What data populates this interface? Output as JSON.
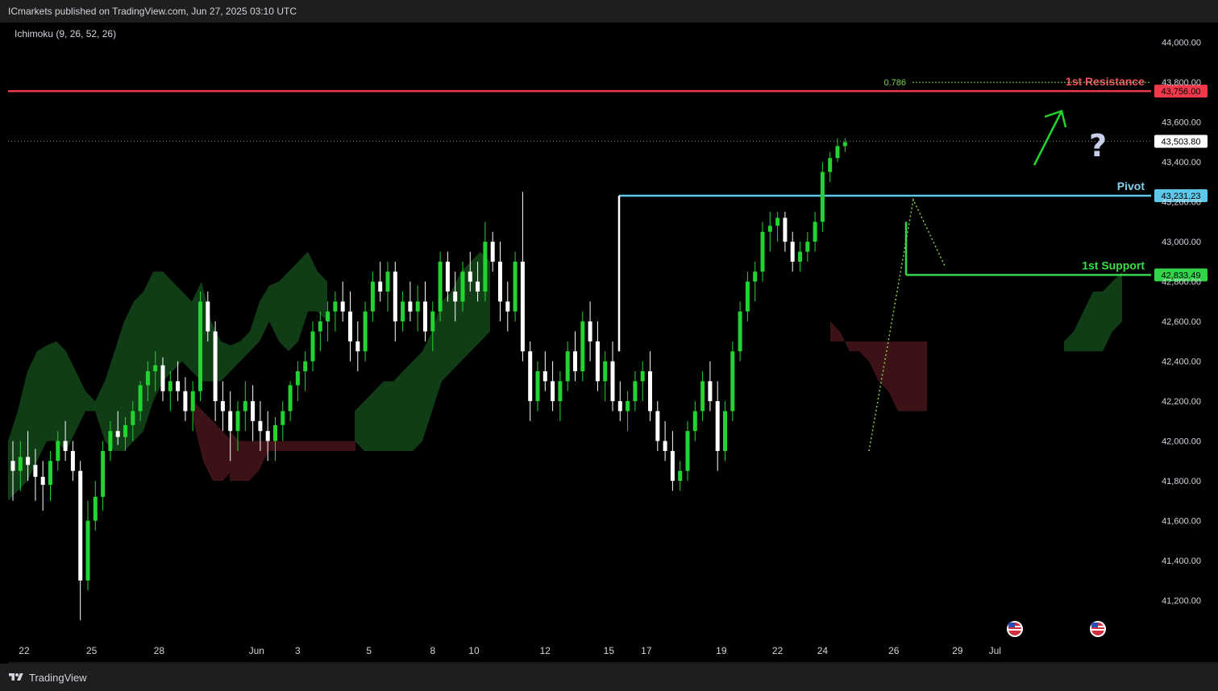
{
  "header": {
    "published": "ICmarkets published on TradingView.com, Jun 27, 2025 03:10 UTC"
  },
  "indicator": {
    "label": "Ichimoku (9, 26, 52, 26)"
  },
  "footer": {
    "brand": "TradingView"
  },
  "colors": {
    "up": "#22d430",
    "down": "#ffffff",
    "resistance": "#f2394b",
    "pivot": "#5ec8e8",
    "support": "#32d54a",
    "cloud_bull": "#113d16",
    "cloud_bear": "#3c1217",
    "axis_bg": "#000000",
    "label_resistance": "#f7525f",
    "label_pivot": "#7fd4ee",
    "label_support": "#35e045",
    "fib": "#7bd34a"
  },
  "icons": [
    "tradingview-logo-icon",
    "question-mark-icon",
    "up-arrow-icon",
    "us-flag-event-icon"
  ],
  "chart_data": {
    "type": "candlestick",
    "title": "",
    "ylim": [
      41000,
      44100
    ],
    "grid": false,
    "y_ticks": [
      "44,000.00",
      "43,800.00",
      "43,600.00",
      "43,400.00",
      "43,200.00",
      "43,000.00",
      "42,800.00",
      "42,600.00",
      "42,400.00",
      "42,200.00",
      "42,000.00",
      "41,800.00",
      "41,600.00",
      "41,400.00",
      "41,200.00"
    ],
    "x_ticks": [
      {
        "label": "22",
        "index": 1.5
      },
      {
        "label": "25",
        "index": 10.5
      },
      {
        "label": "28",
        "index": 19.5
      },
      {
        "label": "Jun",
        "index": 32.5
      },
      {
        "label": "3",
        "index": 38
      },
      {
        "label": "5",
        "index": 47.5
      },
      {
        "label": "8",
        "index": 56
      },
      {
        "label": "10",
        "index": 61.5
      },
      {
        "label": "12",
        "index": 71
      },
      {
        "label": "15",
        "index": 79.5
      },
      {
        "label": "17",
        "index": 84.5
      },
      {
        "label": "19",
        "index": 94.5
      },
      {
        "label": "22",
        "index": 102
      },
      {
        "label": "24",
        "index": 108
      },
      {
        "label": "26",
        "index": 117.5
      },
      {
        "label": "29",
        "index": 126
      },
      {
        "label": "Jul",
        "index": 131
      }
    ],
    "levels": [
      {
        "name": "1st Resistance",
        "value": 43756.0,
        "label": "43,756.00",
        "role": "resistance"
      },
      {
        "name": "Pivot",
        "value": 43231.23,
        "label": "43,231.23",
        "role": "pivot"
      },
      {
        "name": "1st Support",
        "value": 42833.49,
        "label": "42,833.49",
        "role": "support"
      }
    ],
    "last_price": {
      "value": 43503.8,
      "label": "43,503.80"
    },
    "fib": {
      "label": "0.786",
      "value": 43800
    },
    "candles": [
      [
        41900,
        42000,
        41700,
        41850
      ],
      [
        41850,
        42000,
        41750,
        41920
      ],
      [
        41920,
        42050,
        41800,
        41880
      ],
      [
        41880,
        41960,
        41700,
        41820
      ],
      [
        41820,
        41900,
        41650,
        41780
      ],
      [
        41780,
        41950,
        41700,
        41900
      ],
      [
        41900,
        42050,
        41850,
        42000
      ],
      [
        42000,
        42100,
        41900,
        41950
      ],
      [
        41950,
        42000,
        41800,
        41850
      ],
      [
        41850,
        41900,
        41100,
        41300
      ],
      [
        41300,
        41700,
        41250,
        41600
      ],
      [
        41600,
        41800,
        41550,
        41720
      ],
      [
        41720,
        42000,
        41650,
        41950
      ],
      [
        41950,
        42100,
        41900,
        42050
      ],
      [
        42050,
        42150,
        41980,
        42020
      ],
      [
        42020,
        42120,
        41950,
        42080
      ],
      [
        42080,
        42200,
        42000,
        42150
      ],
      [
        42150,
        42300,
        42100,
        42280
      ],
      [
        42280,
        42400,
        42200,
        42350
      ],
      [
        42350,
        42450,
        42250,
        42380
      ],
      [
        42380,
        42420,
        42200,
        42250
      ],
      [
        42250,
        42350,
        42150,
        42300
      ],
      [
        42300,
        42400,
        42200,
        42250
      ],
      [
        42250,
        42320,
        42100,
        42150
      ],
      [
        42150,
        42300,
        42050,
        42250
      ],
      [
        42250,
        42750,
        42200,
        42700
      ],
      [
        42700,
        42750,
        42500,
        42550
      ],
      [
        42550,
        42600,
        42100,
        42200
      ],
      [
        42200,
        42300,
        42050,
        42150
      ],
      [
        42150,
        42250,
        41900,
        42050
      ],
      [
        42050,
        42200,
        41950,
        42150
      ],
      [
        42150,
        42300,
        42050,
        42200
      ],
      [
        42200,
        42280,
        42000,
        42100
      ],
      [
        42100,
        42200,
        41950,
        42050
      ],
      [
        42050,
        42150,
        41900,
        42000
      ],
      [
        42000,
        42120,
        41900,
        42080
      ],
      [
        42080,
        42200,
        42000,
        42150
      ],
      [
        42150,
        42300,
        42100,
        42280
      ],
      [
        42280,
        42400,
        42200,
        42350
      ],
      [
        42350,
        42450,
        42250,
        42400
      ],
      [
        42400,
        42600,
        42350,
        42550
      ],
      [
        42550,
        42650,
        42450,
        42600
      ],
      [
        42600,
        42700,
        42500,
        42650
      ],
      [
        42650,
        42750,
        42550,
        42700
      ],
      [
        42700,
        42800,
        42600,
        42650
      ],
      [
        42650,
        42750,
        42400,
        42500
      ],
      [
        42500,
        42600,
        42350,
        42450
      ],
      [
        42450,
        42700,
        42400,
        42650
      ],
      [
        42650,
        42850,
        42600,
        42800
      ],
      [
        42800,
        42900,
        42700,
        42750
      ],
      [
        42750,
        42900,
        42650,
        42850
      ],
      [
        42850,
        42900,
        42500,
        42600
      ],
      [
        42600,
        42750,
        42550,
        42700
      ],
      [
        42700,
        42800,
        42600,
        42650
      ],
      [
        42650,
        42780,
        42550,
        42700
      ],
      [
        42700,
        42800,
        42500,
        42550
      ],
      [
        42550,
        42700,
        42450,
        42650
      ],
      [
        42650,
        42950,
        42600,
        42900
      ],
      [
        42900,
        42950,
        42700,
        42750
      ],
      [
        42750,
        42850,
        42600,
        42700
      ],
      [
        42700,
        42900,
        42650,
        42850
      ],
      [
        42850,
        42950,
        42750,
        42800
      ],
      [
        42800,
        42900,
        42700,
        42750
      ],
      [
        42750,
        43100,
        42700,
        43000
      ],
      [
        43000,
        43050,
        42850,
        42900
      ],
      [
        42900,
        43000,
        42600,
        42700
      ],
      [
        42700,
        42800,
        42550,
        42650
      ],
      [
        42650,
        42950,
        42600,
        42900
      ],
      [
        42900,
        43250,
        42400,
        42450
      ],
      [
        42450,
        42500,
        42100,
        42200
      ],
      [
        42200,
        42400,
        42150,
        42350
      ],
      [
        42350,
        42450,
        42250,
        42300
      ],
      [
        42300,
        42400,
        42150,
        42200
      ],
      [
        42200,
        42350,
        42100,
        42300
      ],
      [
        42300,
        42500,
        42250,
        42450
      ],
      [
        42450,
        42550,
        42300,
        42350
      ],
      [
        42350,
        42650,
        42300,
        42600
      ],
      [
        42600,
        42700,
        42400,
        42500
      ],
      [
        42500,
        42600,
        42250,
        42300
      ],
      [
        42300,
        42450,
        42200,
        42400
      ],
      [
        42400,
        42500,
        42150,
        42200
      ],
      [
        42200,
        42300,
        42100,
        42150
      ],
      [
        42150,
        42250,
        42050,
        42200
      ],
      [
        42200,
        42350,
        42150,
        42300
      ],
      [
        42300,
        42400,
        42200,
        42350
      ],
      [
        42350,
        42450,
        42100,
        42150
      ],
      [
        42150,
        42200,
        41950,
        42000
      ],
      [
        42000,
        42100,
        41900,
        41950
      ],
      [
        41950,
        42050,
        41750,
        41800
      ],
      [
        41800,
        41900,
        41750,
        41850
      ],
      [
        41850,
        42100,
        41800,
        42050
      ],
      [
        42050,
        42200,
        42000,
        42150
      ],
      [
        42150,
        42350,
        42100,
        42300
      ],
      [
        42300,
        42400,
        42150,
        42200
      ],
      [
        42200,
        42300,
        41850,
        41950
      ],
      [
        41950,
        42200,
        41900,
        42150
      ],
      [
        42150,
        42500,
        42100,
        42450
      ],
      [
        42450,
        42700,
        42400,
        42650
      ],
      [
        42650,
        42850,
        42600,
        42800
      ],
      [
        42800,
        42900,
        42700,
        42850
      ],
      [
        42850,
        43100,
        42800,
        43050
      ],
      [
        43050,
        43150,
        42950,
        43080
      ],
      [
        43080,
        43150,
        43000,
        43120
      ],
      [
        43120,
        43150,
        42950,
        43000
      ],
      [
        43000,
        43050,
        42850,
        42900
      ],
      [
        42900,
        43000,
        42850,
        42950
      ],
      [
        42950,
        43050,
        42900,
        43000
      ],
      [
        43000,
        43150,
        42950,
        43100
      ],
      [
        43100,
        43400,
        43050,
        43350
      ],
      [
        43350,
        43450,
        43300,
        43420
      ],
      [
        43420,
        43520,
        43400,
        43480
      ],
      [
        43480,
        43520,
        43450,
        43500
      ]
    ],
    "cloud": {
      "bull_upper": [
        42000,
        42150,
        42350,
        42450,
        42480,
        42500,
        42450,
        42350,
        42250,
        42200,
        42300,
        42450,
        42600,
        42700,
        42750,
        42850,
        42850,
        42800,
        42750,
        42700,
        42800,
        42600,
        42500,
        42480,
        42500,
        42550,
        42700,
        42780,
        42800,
        42850,
        42900,
        42950,
        42850,
        42800
      ],
      "bull_lower": [
        41700,
        41750,
        41800,
        41900,
        42000,
        42000,
        41950,
        42050,
        42150,
        42150,
        42000,
        41950,
        41950,
        42000,
        42050,
        42200,
        42300,
        42350,
        42400,
        42350,
        42300,
        42300,
        42300,
        42350,
        42400,
        42450,
        42500,
        42600,
        42500,
        42450,
        42500,
        42650,
        42650,
        42600
      ]
    }
  }
}
